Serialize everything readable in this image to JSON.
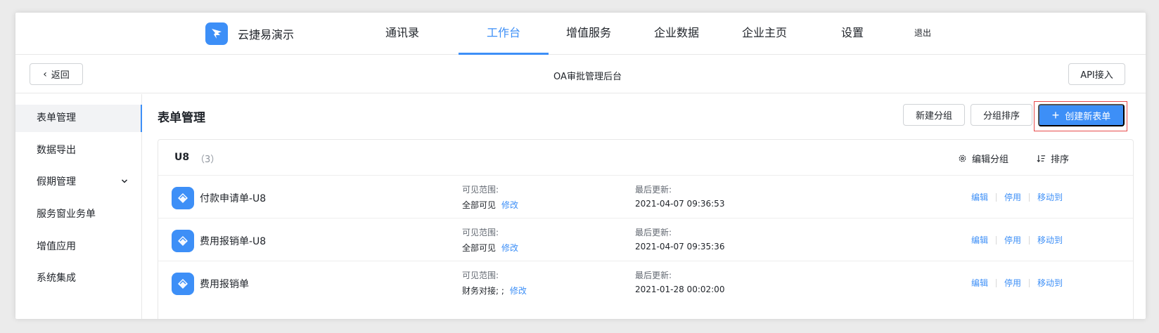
{
  "brand": {
    "name": "云捷易演示",
    "color": "#3d8ff7"
  },
  "nav": {
    "items": [
      {
        "label": "通讯录"
      },
      {
        "label": "工作台",
        "active": true
      },
      {
        "label": "增值服务"
      },
      {
        "label": "企业数据"
      },
      {
        "label": "企业主页"
      },
      {
        "label": "设置"
      },
      {
        "label": "退出"
      }
    ]
  },
  "subheader": {
    "back_label": "返回",
    "title": "OA审批管理后台",
    "api_label": "API接入"
  },
  "sidebar": {
    "items": [
      {
        "label": "表单管理",
        "active": true
      },
      {
        "label": "数据导出"
      },
      {
        "label": "假期管理",
        "icon": "chevron-down-icon"
      },
      {
        "label": "服务窗业务单"
      },
      {
        "label": "增值应用"
      },
      {
        "label": "系统集成"
      }
    ]
  },
  "main": {
    "title": "表单管理",
    "new_group_label": "新建分组",
    "sort_group_label": "分组排序",
    "create_form_label": "创建新表单"
  },
  "group": {
    "name": "U8",
    "count": "（3）",
    "edit_label": "编辑分组",
    "sort_label": "排序",
    "rows": [
      {
        "name": "付款申请单-U8",
        "scope_label": "可见范围:",
        "scope_value": "全部可见",
        "scope_edit": "修改",
        "updated_label": "最后更新:",
        "updated_value": "2021-04-07 09:36:53",
        "actions": [
          "编辑",
          "停用",
          "移动到"
        ]
      },
      {
        "name": "费用报销单-U8",
        "scope_label": "可见范围:",
        "scope_value": "全部可见",
        "scope_edit": "修改",
        "updated_label": "最后更新:",
        "updated_value": "2021-04-07 09:35:36",
        "actions": [
          "编辑",
          "停用",
          "移动到"
        ]
      },
      {
        "name": "费用报销单",
        "scope_label": "可见范围:",
        "scope_value": "财务对接; ;",
        "scope_edit": "修改",
        "updated_label": "最后更新:",
        "updated_value": "2021-01-28 00:02:00",
        "actions": [
          "编辑",
          "停用",
          "移动到"
        ]
      }
    ]
  }
}
